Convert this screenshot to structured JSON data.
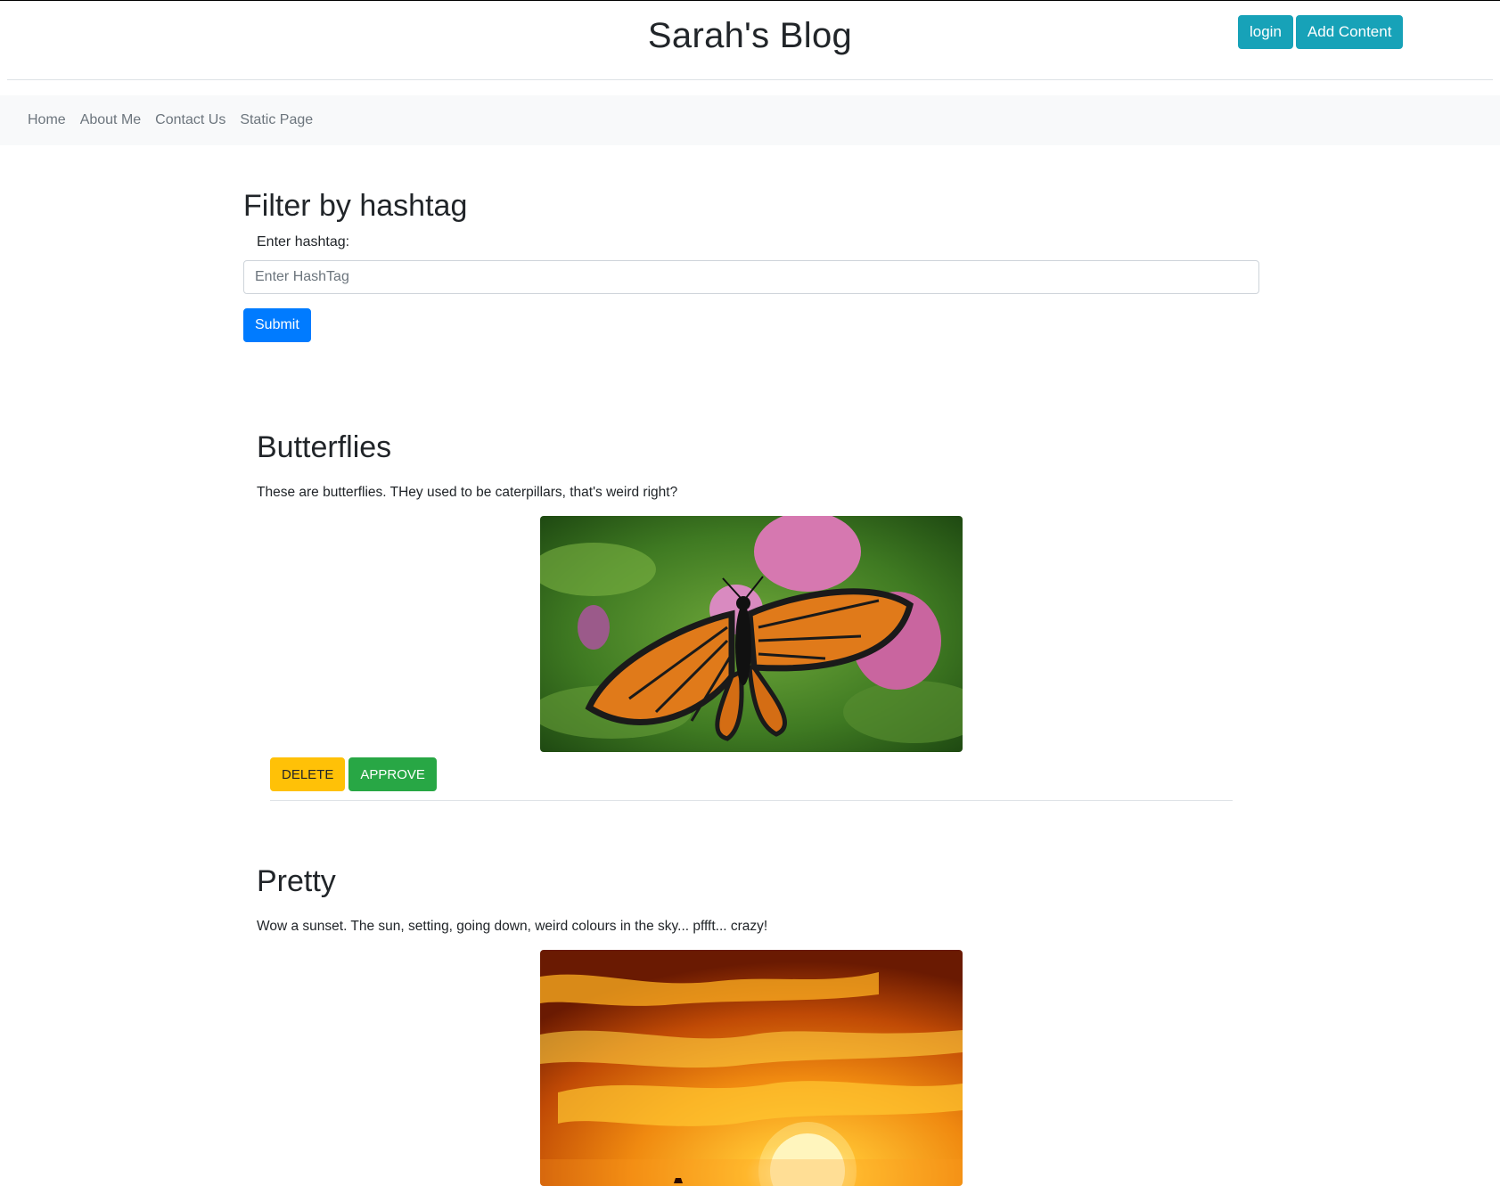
{
  "header": {
    "title": "Sarah's Blog",
    "login_label": "login",
    "add_content_label": "Add Content"
  },
  "nav": {
    "items": [
      "Home",
      "About Me",
      "Contact Us",
      "Static Page"
    ]
  },
  "filter": {
    "heading": "Filter by hashtag",
    "label": "Enter hashtag:",
    "placeholder": "Enter HashTag",
    "value": "",
    "submit_label": "Submit"
  },
  "posts": [
    {
      "title": "Butterflies",
      "body": "These are butterflies. THey used to be caterpillars, that's weird right?",
      "image_icon": "butterfly-photo",
      "delete_label": "DELETE",
      "approve_label": "APPROVE"
    },
    {
      "title": "Pretty",
      "body": "Wow a sunset. The sun, setting, going down, weird colours in the sky... pffft... crazy!",
      "image_icon": "sunset-photo"
    }
  ],
  "colors": {
    "info": "#17a2b8",
    "primary": "#007bff",
    "warning": "#ffc107",
    "success": "#28a745",
    "navbar_bg": "#f8f9fa"
  }
}
